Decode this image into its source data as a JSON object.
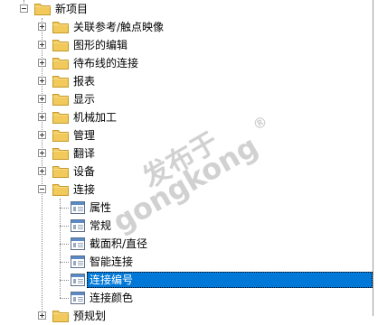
{
  "tree": {
    "root": {
      "label": "新项目"
    },
    "items": [
      {
        "label": "关联参考/触点映像"
      },
      {
        "label": "图形的编辑"
      },
      {
        "label": "待布线的连接"
      },
      {
        "label": "报表"
      },
      {
        "label": "显示"
      },
      {
        "label": "机械加工"
      },
      {
        "label": "管理"
      },
      {
        "label": "翻译"
      },
      {
        "label": "设备"
      },
      {
        "label": "连接",
        "children": [
          {
            "label": "属性"
          },
          {
            "label": "常规"
          },
          {
            "label": "截面积/直径"
          },
          {
            "label": "智能连接"
          },
          {
            "label": "连接编号",
            "selected": true
          },
          {
            "label": "连接颜色"
          }
        ]
      },
      {
        "label": "预规划"
      }
    ]
  },
  "watermark": {
    "line1": "发布于",
    "line2": "gongkong",
    "mark": "®"
  },
  "colors": {
    "selection": "#0078d7",
    "folder": "#f2c95b",
    "page_header": "#5b8bc6"
  }
}
